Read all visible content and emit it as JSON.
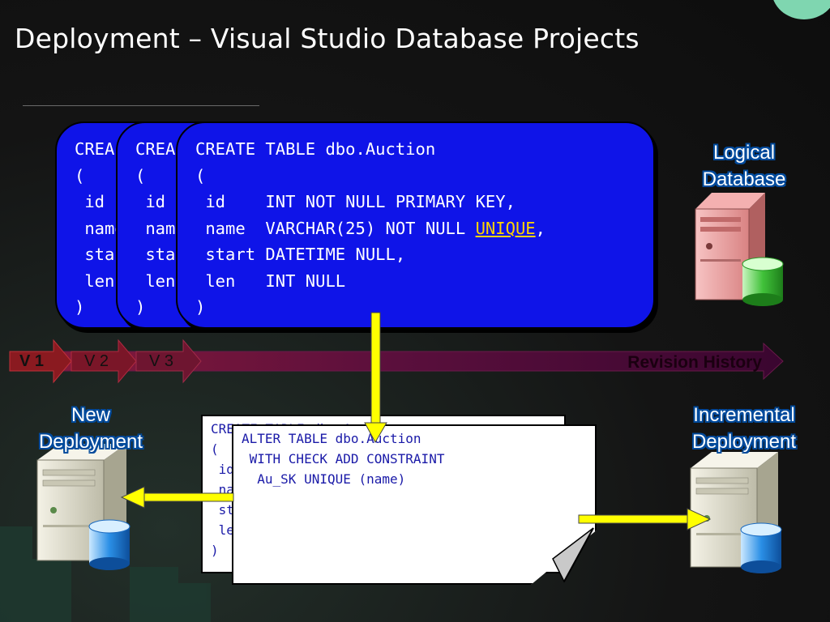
{
  "slide": {
    "title": "Deployment – Visual Studio Database Projects"
  },
  "code_card_front": {
    "lines": [
      "CREATE TABLE dbo.Auction",
      "(",
      " id    INT NOT NULL PRIMARY KEY,",
      " name  VARCHAR(25) NOT NULL ",
      " start DATETIME NULL,",
      " len   INT NULL",
      ")"
    ],
    "unique_keyword": "UNIQUE",
    "after_unique": ","
  },
  "code_card_back": {
    "col_lines": [
      "CREA",
      "(",
      " id",
      " name",
      " start",
      " len",
      ")"
    ]
  },
  "labels": {
    "logical_database": [
      "Logical",
      "Database"
    ],
    "new_deployment": [
      "New",
      "Deployment"
    ],
    "incremental_deployment": [
      "Incremental",
      "Deployment"
    ],
    "revision_history": "Revision History"
  },
  "versions": [
    "V 1",
    "V 2",
    "V 3"
  ],
  "script_note_back": {
    "lines": [
      "CREATE TABLE dbo.Auction",
      "(",
      " id",
      " na",
      " st",
      " le",
      ")"
    ]
  },
  "script_note_front": {
    "lines": [
      "ALTER TABLE dbo.Auction",
      " WITH CHECK ADD CONSTRAINT",
      "  Au_SK UNIQUE (name)"
    ]
  },
  "colors": {
    "code_card": "#0f14e8",
    "unique_highlight": "#ffd400",
    "arrow": "#ffff00",
    "timeline": "#5a0f3c",
    "label_outline": "#004a9c"
  },
  "icons": {
    "logical_server": "pink-server-green-db-icon",
    "new_server": "server-blue-db-icon",
    "incremental_server": "server-blue-db-icon"
  }
}
